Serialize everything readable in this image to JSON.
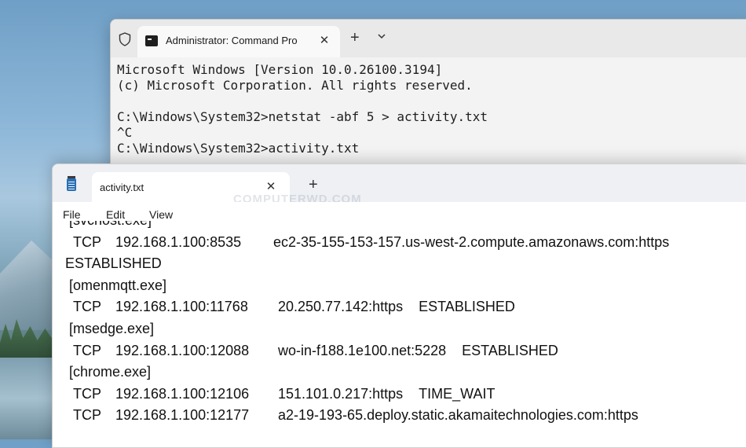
{
  "terminal": {
    "tab_title": "Administrator: Command Pro",
    "lines": [
      "Microsoft Windows [Version 10.0.26100.3194]",
      "(c) Microsoft Corporation. All rights reserved.",
      "",
      "C:\\Windows\\System32>netstat -abf 5 > activity.txt",
      "^C",
      "C:\\Windows\\System32>activity.txt"
    ]
  },
  "notepad": {
    "tab_title": "activity.txt",
    "watermark": "COMPUTERWD.COM",
    "menu": [
      "File",
      "Edit",
      "View"
    ],
    "lines": [
      {
        "kind": "proc",
        "name": "[svchost.exe]"
      },
      {
        "kind": "conn",
        "proto": "TCP",
        "local": "192.168.1.100:8535",
        "foreign": "ec2-35-155-153-157.us-west-2.compute.amazonaws.com:https",
        "state": ""
      },
      {
        "kind": "wrap",
        "text": "ESTABLISHED"
      },
      {
        "kind": "proc",
        "name": "[omenmqtt.exe]"
      },
      {
        "kind": "conn",
        "proto": "TCP",
        "local": "192.168.1.100:11768",
        "foreign": "20.250.77.142:https",
        "state": "ESTABLISHED"
      },
      {
        "kind": "proc",
        "name": "[msedge.exe]"
      },
      {
        "kind": "conn",
        "proto": "TCP",
        "local": "192.168.1.100:12088",
        "foreign": "wo-in-f188.1e100.net:5228",
        "state": "ESTABLISHED"
      },
      {
        "kind": "proc",
        "name": "[chrome.exe]"
      },
      {
        "kind": "conn",
        "proto": "TCP",
        "local": "192.168.1.100:12106",
        "foreign": "151.101.0.217:https",
        "state": "TIME_WAIT"
      },
      {
        "kind": "conn",
        "proto": "TCP",
        "local": "192.168.1.100:12177",
        "foreign": "a2-19-193-65.deploy.static.akamaitechnologies.com:https",
        "state": ""
      }
    ]
  }
}
